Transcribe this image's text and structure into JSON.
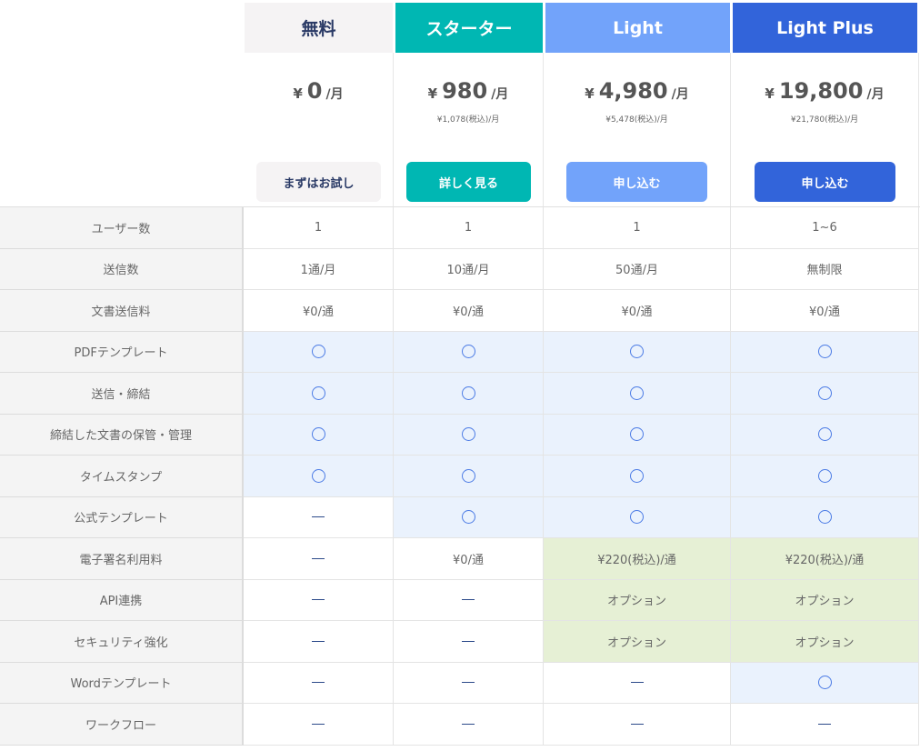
{
  "plans": [
    {
      "name": "無料",
      "header_bg": "#f5f3f4",
      "header_fg": "#2a3a66",
      "yen": "¥",
      "price": "0",
      "per": "/月",
      "tax": "",
      "cta": "まずはお試し",
      "cta_bg": "#f5f3f4",
      "cta_fg": "#2a3a66"
    },
    {
      "name": "スターター",
      "header_bg": "#00b7b3",
      "header_fg": "#ffffff",
      "yen": "¥",
      "price": "980",
      "per": "/月",
      "tax": "¥1,078(税込)/月",
      "cta": "詳しく見る",
      "cta_bg": "#00b7b3",
      "cta_fg": "#ffffff"
    },
    {
      "name": "Light",
      "header_bg": "#72a3fa",
      "header_fg": "#ffffff",
      "yen": "¥",
      "price": "4,980",
      "per": "/月",
      "tax": "¥5,478(税込)/月",
      "cta": "申し込む",
      "cta_bg": "#72a3fa",
      "cta_fg": "#ffffff"
    },
    {
      "name": "Light Plus",
      "header_bg": "#3264da",
      "header_fg": "#ffffff",
      "yen": "¥",
      "price": "19,800",
      "per": "/月",
      "tax": "¥21,780(税込)/月",
      "cta": "申し込む",
      "cta_bg": "#3264da",
      "cta_fg": "#ffffff"
    }
  ],
  "features": [
    {
      "label": "ユーザー数",
      "values": [
        {
          "t": "text",
          "v": "1"
        },
        {
          "t": "text",
          "v": "1"
        },
        {
          "t": "text",
          "v": "1"
        },
        {
          "t": "text",
          "v": "1~6"
        }
      ]
    },
    {
      "label": "送信数",
      "values": [
        {
          "t": "text",
          "v": "1通/月"
        },
        {
          "t": "text",
          "v": "10通/月"
        },
        {
          "t": "text",
          "v": "50通/月"
        },
        {
          "t": "text",
          "v": "無制限"
        }
      ]
    },
    {
      "label": "文書送信料",
      "values": [
        {
          "t": "text",
          "v": "¥0/通"
        },
        {
          "t": "text",
          "v": "¥0/通"
        },
        {
          "t": "text",
          "v": "¥0/通"
        },
        {
          "t": "text",
          "v": "¥0/通"
        }
      ]
    },
    {
      "label": "PDFテンプレート",
      "values": [
        {
          "t": "yes"
        },
        {
          "t": "yes"
        },
        {
          "t": "yes"
        },
        {
          "t": "yes"
        }
      ]
    },
    {
      "label": "送信・締結",
      "values": [
        {
          "t": "yes"
        },
        {
          "t": "yes"
        },
        {
          "t": "yes"
        },
        {
          "t": "yes"
        }
      ]
    },
    {
      "label": "締結した文書の保管・管理",
      "values": [
        {
          "t": "yes"
        },
        {
          "t": "yes"
        },
        {
          "t": "yes"
        },
        {
          "t": "yes"
        }
      ]
    },
    {
      "label": "タイムスタンプ",
      "values": [
        {
          "t": "yes"
        },
        {
          "t": "yes"
        },
        {
          "t": "yes"
        },
        {
          "t": "yes"
        }
      ]
    },
    {
      "label": "公式テンプレート",
      "values": [
        {
          "t": "no"
        },
        {
          "t": "yes"
        },
        {
          "t": "yes"
        },
        {
          "t": "yes"
        }
      ]
    },
    {
      "label": "電子署名利用料",
      "values": [
        {
          "t": "no"
        },
        {
          "t": "text",
          "v": "¥0/通"
        },
        {
          "t": "option",
          "v": "¥220(税込)/通"
        },
        {
          "t": "option",
          "v": "¥220(税込)/通"
        }
      ]
    },
    {
      "label": "API連携",
      "values": [
        {
          "t": "no"
        },
        {
          "t": "no"
        },
        {
          "t": "option",
          "v": "オプション"
        },
        {
          "t": "option",
          "v": "オプション"
        }
      ]
    },
    {
      "label": "セキュリティ強化",
      "values": [
        {
          "t": "no"
        },
        {
          "t": "no"
        },
        {
          "t": "option",
          "v": "オプション"
        },
        {
          "t": "option",
          "v": "オプション"
        }
      ]
    },
    {
      "label": "Wordテンプレート",
      "values": [
        {
          "t": "no"
        },
        {
          "t": "no"
        },
        {
          "t": "no"
        },
        {
          "t": "yes"
        }
      ]
    },
    {
      "label": "ワークフロー",
      "values": [
        {
          "t": "no"
        },
        {
          "t": "no"
        },
        {
          "t": "no"
        },
        {
          "t": "no"
        }
      ]
    }
  ],
  "icons": {
    "yes": "circle-icon",
    "no": "dash-icon"
  },
  "colors": {
    "yes_bg": "#eaf2fd",
    "option_bg": "#e6f0d5",
    "label_bg": "#f4f4f4"
  }
}
